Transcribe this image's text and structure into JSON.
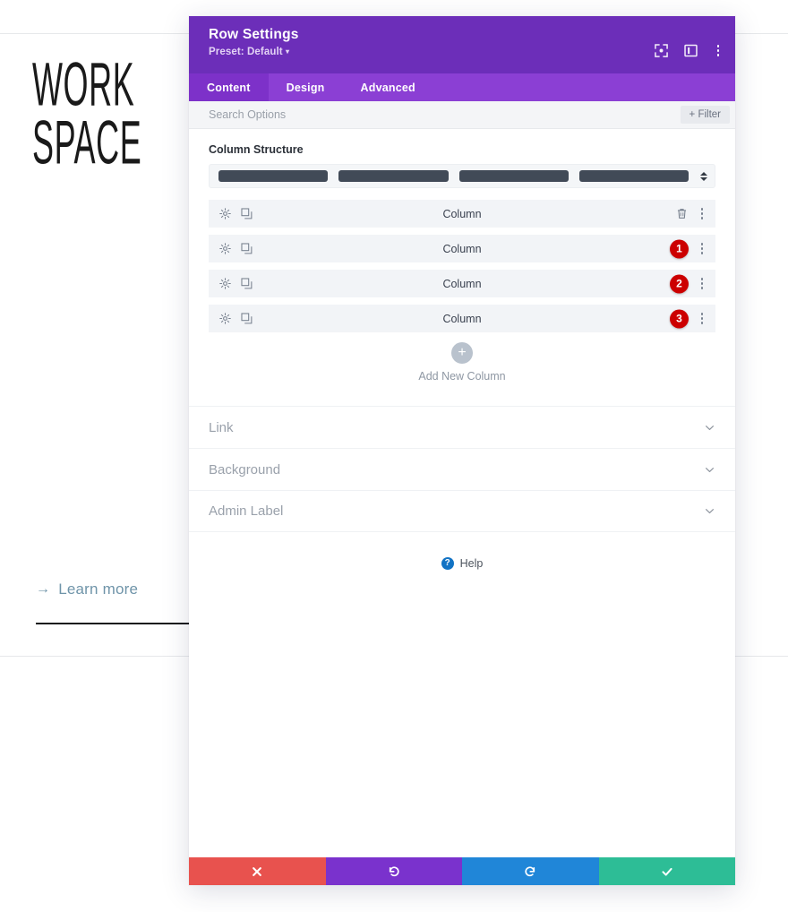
{
  "canvas": {
    "logo_line1": "WORK",
    "logo_line2": "SPACE",
    "learn_more": "Learn more",
    "learn_more_arrow": "→"
  },
  "modal": {
    "title": "Row Settings",
    "preset": "Preset: Default",
    "preset_caret": "▾",
    "header_icons": [
      {
        "name": "fullscreen-icon"
      },
      {
        "name": "panel-layout-icon"
      },
      {
        "name": "more-options-icon"
      }
    ],
    "tabs": [
      {
        "label": "Content",
        "active": true
      },
      {
        "label": "Design",
        "active": false
      },
      {
        "label": "Advanced",
        "active": false
      }
    ],
    "search": {
      "placeholder": "Search Options",
      "value": "",
      "filter_label": "+ Filter"
    },
    "column_structure": {
      "label": "Column Structure",
      "bars": 4
    },
    "columns": [
      {
        "label": "Column",
        "badge": ""
      },
      {
        "label": "Column",
        "badge": "1"
      },
      {
        "label": "Column",
        "badge": "2"
      },
      {
        "label": "Column",
        "badge": "3"
      }
    ],
    "add_new_column": {
      "plus": "+",
      "label": "Add New Column"
    },
    "accordions": [
      {
        "label": "Link"
      },
      {
        "label": "Background"
      },
      {
        "label": "Admin Label"
      }
    ],
    "help": {
      "glyph": "?",
      "label": "Help"
    },
    "footer": [
      {
        "name": "cancel-button",
        "icon": "x-icon",
        "color": "#e8524e"
      },
      {
        "name": "undo-button",
        "icon": "undo-icon",
        "color": "#7a32cd"
      },
      {
        "name": "redo-button",
        "icon": "redo-icon",
        "color": "#2086d8"
      },
      {
        "name": "save-button",
        "icon": "check-icon",
        "color": "#2dbd96"
      }
    ]
  },
  "colors": {
    "header_purple": "#6c2eb9",
    "tabbar_purple": "#8b3fd4",
    "active_tab_purple": "#7d31c9",
    "badge_red": "#cc0000",
    "struct_bar": "#414a57",
    "link_teal": "#6f94a9"
  }
}
